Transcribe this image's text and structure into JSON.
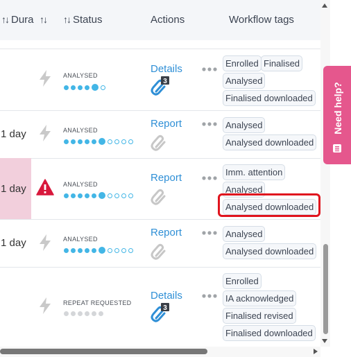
{
  "headers": {
    "duration": "Dura",
    "status": "Status",
    "actions": "Actions",
    "workflow_tags": "Workflow tags"
  },
  "rows": [
    {
      "duration": "",
      "status": "ANALYSED",
      "dots": [
        "f",
        "f",
        "f",
        "f",
        "big",
        "e"
      ],
      "action": "Details",
      "attachment_badge": "3",
      "tags": [
        "Enrolled",
        "Finalised",
        "Analysed",
        "Finalised downloaded"
      ]
    },
    {
      "duration": "1 day",
      "status": "ANALYSED",
      "dots": [
        "f",
        "f",
        "f",
        "f",
        "f",
        "big",
        "e",
        "e",
        "e",
        "e"
      ],
      "action": "Report",
      "tags": [
        "Analysed",
        "Analysed downloaded"
      ]
    },
    {
      "duration": "1 day",
      "status": "ANALYSED",
      "dots": [
        "f",
        "f",
        "f",
        "f",
        "f",
        "big",
        "e",
        "e",
        "e",
        "e"
      ],
      "action": "Report",
      "tags": [
        "Imm. attention",
        "Analysed",
        "Analysed downloaded"
      ]
    },
    {
      "duration": "1 day",
      "status": "ANALYSED",
      "dots": [
        "f",
        "f",
        "f",
        "f",
        "f",
        "big",
        "e",
        "e",
        "e",
        "e"
      ],
      "action": "Report",
      "tags": [
        "Analysed",
        "Analysed downloaded"
      ]
    },
    {
      "duration": "",
      "status": "REPEAT REQUESTED",
      "dots": [
        "g",
        "g",
        "g",
        "g",
        "g",
        "g"
      ],
      "action": "Details",
      "attachment_badge": "3",
      "tags": [
        "Enrolled",
        "IA acknowledged",
        "Finalised revised",
        "Finalised downloaded"
      ]
    }
  ],
  "help_button": "Need help?",
  "colors": {
    "accent": "#2f8fd6",
    "dot_active": "#43b6e6",
    "highlight": "#e0141e",
    "help": "#e5578d",
    "flagged_row": "#f2cfdc"
  }
}
